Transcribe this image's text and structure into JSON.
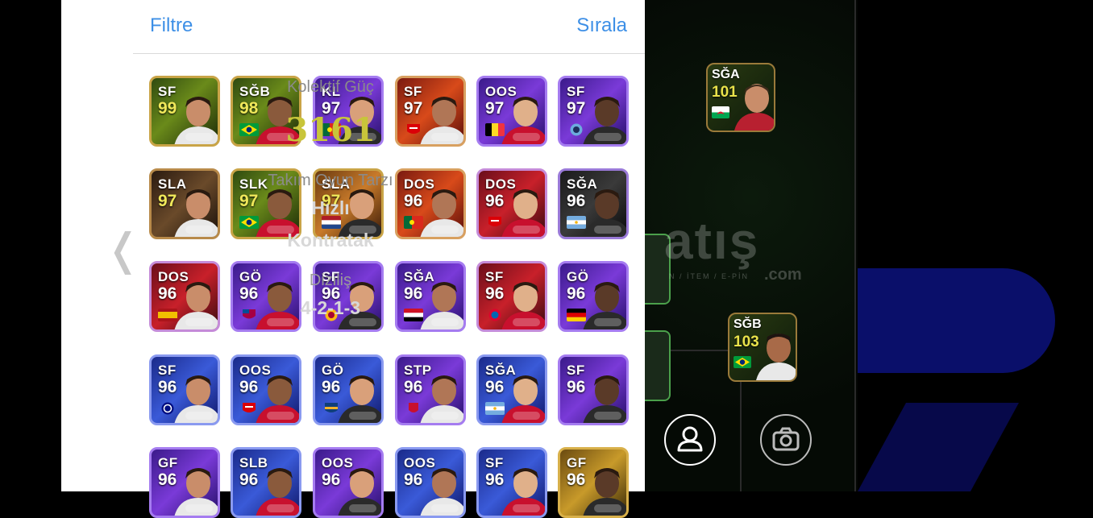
{
  "panel": {
    "filter_label": "Filtre",
    "sort_label": "Sırala"
  },
  "colors": {
    "accent_blue": "#3d8fe6",
    "power_yellow": "#c8c53a"
  },
  "cards": [
    {
      "pos": "SF",
      "rating": "99",
      "flag": "none",
      "theme": "green-gold"
    },
    {
      "pos": "SĞB",
      "rating": "98",
      "flag": "brazil",
      "theme": "green-gold"
    },
    {
      "pos": "KL",
      "rating": "97",
      "flag": "portugal",
      "theme": "purple"
    },
    {
      "pos": "SF",
      "rating": "97",
      "flag": "arsenal",
      "theme": "red-orange"
    },
    {
      "pos": "OOS",
      "rating": "97",
      "flag": "belgium",
      "theme": "purple"
    },
    {
      "pos": "SF",
      "rating": "97",
      "flag": "mancity",
      "theme": "purple"
    },
    {
      "pos": "SLA",
      "rating": "97",
      "flag": "none",
      "theme": "dark-gold"
    },
    {
      "pos": "SLK",
      "rating": "97",
      "flag": "brazil",
      "theme": "green-gold"
    },
    {
      "pos": "SLA",
      "rating": "97",
      "flag": "netherlands",
      "theme": "orange"
    },
    {
      "pos": "DOS",
      "rating": "96",
      "flag": "portugal",
      "theme": "red-orange"
    },
    {
      "pos": "DOS",
      "rating": "96",
      "flag": "arsenal",
      "theme": "red"
    },
    {
      "pos": "SĞA",
      "rating": "96",
      "flag": "argentina",
      "theme": "dark"
    },
    {
      "pos": "DOS",
      "rating": "96",
      "flag": "spain",
      "theme": "red"
    },
    {
      "pos": "GÖ",
      "rating": "96",
      "flag": "barcelona",
      "theme": "purple"
    },
    {
      "pos": "SF",
      "rating": "96",
      "flag": "galatasaray",
      "theme": "purple"
    },
    {
      "pos": "SĞA",
      "rating": "96",
      "flag": "egypt",
      "theme": "purple"
    },
    {
      "pos": "SF",
      "rating": "96",
      "flag": "bayern",
      "theme": "red"
    },
    {
      "pos": "GÖ",
      "rating": "96",
      "flag": "germany",
      "theme": "purple"
    },
    {
      "pos": "SF",
      "rating": "96",
      "flag": "inter",
      "theme": "blue"
    },
    {
      "pos": "OOS",
      "rating": "96",
      "flag": "arsenal",
      "theme": "blue"
    },
    {
      "pos": "GÖ",
      "rating": "96",
      "flag": "boca",
      "theme": "blue"
    },
    {
      "pos": "STP",
      "rating": "96",
      "flag": "liverpool",
      "theme": "purple"
    },
    {
      "pos": "SĞA",
      "rating": "96",
      "flag": "argentina",
      "theme": "blue"
    },
    {
      "pos": "SF",
      "rating": "96",
      "flag": "none",
      "theme": "purple"
    },
    {
      "pos": "GF",
      "rating": "96",
      "flag": "none",
      "theme": "purple"
    },
    {
      "pos": "SLB",
      "rating": "96",
      "flag": "none",
      "theme": "blue"
    },
    {
      "pos": "OOS",
      "rating": "96",
      "flag": "none",
      "theme": "purple"
    },
    {
      "pos": "OOS",
      "rating": "96",
      "flag": "none",
      "theme": "blue"
    },
    {
      "pos": "SF",
      "rating": "96",
      "flag": "none",
      "theme": "blue"
    },
    {
      "pos": "GF",
      "rating": "96",
      "flag": "none",
      "theme": "gold"
    }
  ],
  "pitch_cards": [
    {
      "pos": "SĞA",
      "rating": "101",
      "flag": "wales"
    },
    {
      "pos": "SĞB",
      "rating": "103",
      "flag": "brazil"
    }
  ],
  "watermark": {
    "main": "atış",
    "sub": "N / İTEM / E-PİN",
    "suffix": ".com"
  },
  "stats": {
    "collective_power_label": "Kolektif Güç",
    "collective_power_value": "3161",
    "team_style_label": "Takım Oyun Tarzı",
    "team_style_line1": "Hızlı",
    "team_style_line2": "Kontratak",
    "formation_label": "Diziliş",
    "formation_value": "4-2-1-3"
  },
  "buttons": {
    "profile_icon": "person-icon",
    "camera_icon": "camera-icon",
    "back_icon": "chevron-left-icon"
  }
}
